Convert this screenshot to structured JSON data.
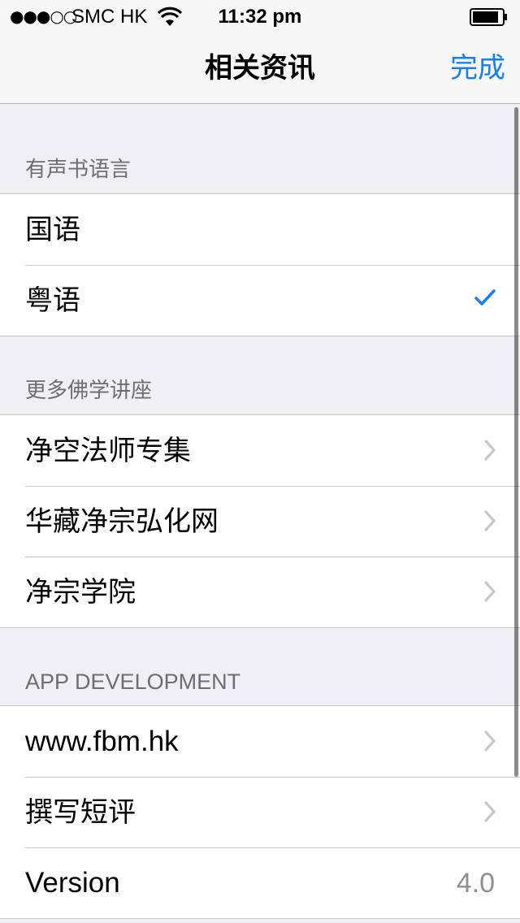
{
  "status_bar": {
    "signal": "●●●○○",
    "carrier": "SMC HK",
    "time": "11:32 pm"
  },
  "nav": {
    "title": "相关资讯",
    "done_label": "完成",
    "accent_color": "#157efb"
  },
  "sections": [
    {
      "header": "有声书语言",
      "rows": [
        {
          "label": "国语",
          "accessory": "none"
        },
        {
          "label": "粤语",
          "accessory": "checkmark-icon"
        }
      ]
    },
    {
      "header": "更多佛学讲座",
      "rows": [
        {
          "label": "净空法师专集",
          "accessory": "chevron-right-icon"
        },
        {
          "label": "华藏净宗弘化网",
          "accessory": "chevron-right-icon"
        },
        {
          "label": "净宗学院",
          "accessory": "chevron-right-icon"
        }
      ]
    },
    {
      "header": "APP DEVELOPMENT",
      "rows": [
        {
          "label": "www.fbm.hk",
          "accessory": "chevron-right-icon"
        },
        {
          "label": "撰写短评",
          "accessory": "chevron-right-icon"
        },
        {
          "label": "Version",
          "value": "4.0"
        }
      ]
    }
  ]
}
